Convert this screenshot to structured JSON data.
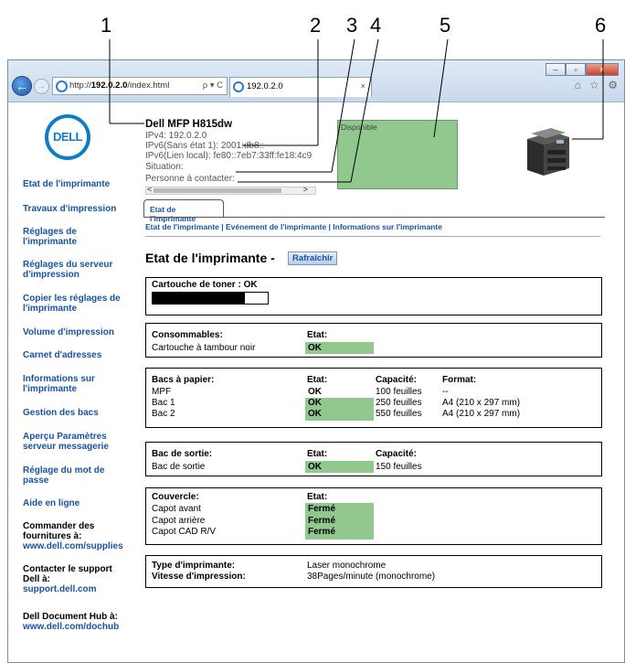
{
  "callouts": [
    "1",
    "2",
    "3",
    "4",
    "5",
    "6"
  ],
  "browser": {
    "address_prefix": "http://",
    "address_host": "192.0.2.0",
    "address_suffix": "/index.html",
    "address_tools": "ρ ▾ C",
    "tab_title": "192.0.2.0",
    "tab_close": "×",
    "right_icons": "⌂ ☆ ⚙",
    "back_glyph": "←",
    "forward_glyph": "→",
    "minimize_glyph": "–",
    "maximize_glyph": "▫",
    "close_glyph": "×"
  },
  "sidebar": {
    "logo": "DELL",
    "items": [
      {
        "label": "Etat de l'imprimante"
      },
      {
        "label": "Travaux d'impression"
      },
      {
        "label": "Réglages de l'imprimante"
      },
      {
        "label": "Réglages du serveur d'impression"
      },
      {
        "label": "Copier les réglages de l'imprimante"
      },
      {
        "label": "Volume d'impression"
      },
      {
        "label": "Carnet d'adresses"
      },
      {
        "label": "Informations sur l'imprimante"
      },
      {
        "label": "Gestion des bacs"
      },
      {
        "label": "Aperçu Paramètres serveur messagerie"
      },
      {
        "label": "Réglage du mot de passe"
      },
      {
        "label": "Aide en ligne"
      }
    ],
    "supplies_label": "Commander des fournitures à:",
    "supplies_link": "www.dell.com/supplies",
    "support_label": "Contacter le support Dell à:",
    "support_link": "support.dell.com",
    "dochub_label": "Dell Document Hub à:",
    "dochub_link": "www.dell.com/dochub"
  },
  "header": {
    "device_name": "Dell MFP H815dw",
    "ipv4": "IPv4: 192.0.2.0",
    "ipv6_stateless": "IPv6(Sans état 1): 2001:db8::",
    "ipv6_link": "IPv6(Lien local): fe80::7eb7:33ff:fe18:4c9",
    "situation": "Situation:",
    "contact": "Personne à contacter:",
    "status_panel_text": "Disponible",
    "scroll_left": "<",
    "scroll_right": ">"
  },
  "tabs": {
    "active": "Etat de l'imprimante",
    "subnav": "Etat de l'imprimante | Evénement de l'imprimante | Informations sur l'imprimante"
  },
  "page": {
    "title": "Etat de l'imprimante -",
    "refresh": "Rafraîchir"
  },
  "toner": {
    "label": "Cartouche de toner : OK",
    "level": 0.8
  },
  "consumables": {
    "header": "Consommables:",
    "state_header": "Etat:",
    "item": "Cartouche à tambour noir",
    "state": "OK"
  },
  "trays": {
    "header": "Bacs à papier:",
    "state_header": "Etat:",
    "capacity_header": "Capacité:",
    "format_header": "Format:",
    "rows": [
      {
        "name": "MPF",
        "state": "OK",
        "capacity": "100 feuilles",
        "format": "--",
        "green": false
      },
      {
        "name": "Bac 1",
        "state": "OK",
        "capacity": "250 feuilles",
        "format": "A4 (210 x 297 mm)",
        "green": true
      },
      {
        "name": "Bac 2",
        "state": "OK",
        "capacity": "550 feuilles",
        "format": "A4 (210 x 297 mm)",
        "green": true
      }
    ]
  },
  "output": {
    "header": "Bac de sortie:",
    "state_header": "Etat:",
    "capacity_header": "Capacité:",
    "name": "Bac de sortie",
    "state": "OK",
    "capacity": "150 feuilles"
  },
  "covers": {
    "header": "Couvercle:",
    "state_header": "Etat:",
    "rows": [
      {
        "name": "Capot avant",
        "state": "Fermé"
      },
      {
        "name": "Capot arrière",
        "state": "Fermé"
      },
      {
        "name": "Capot CAD R/V",
        "state": "Fermé"
      }
    ]
  },
  "printer_info": {
    "type_label": "Type d'imprimante:",
    "type_value": "Laser monochrome",
    "speed_label": "Vitesse d'impression:",
    "speed_value": "38Pages/minute (monochrome)"
  },
  "colors": {
    "link": "#1753a6",
    "ok_green": "#90c88e"
  }
}
